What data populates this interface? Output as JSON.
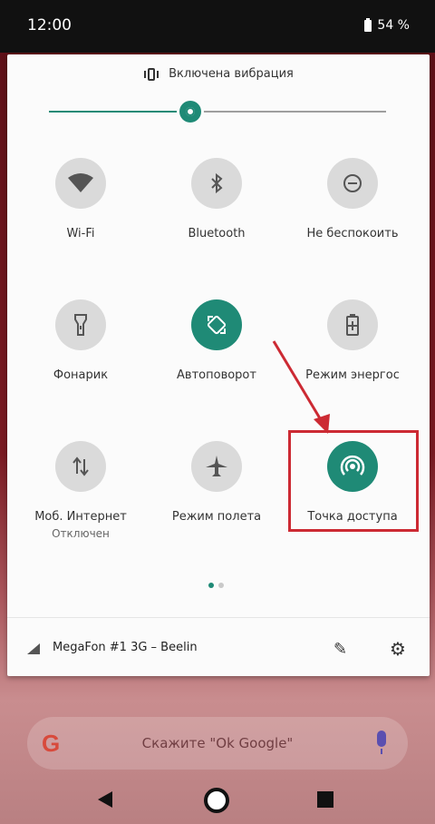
{
  "status": {
    "time": "12:00",
    "battery": "54 %"
  },
  "quick_settings": {
    "vibration_label": "Включена вибрация",
    "brightness": 0.42,
    "tiles": [
      {
        "label": "Wi-Fi",
        "sub": "",
        "icon": "wifi-icon",
        "active": false
      },
      {
        "label": "Bluetooth",
        "sub": "",
        "icon": "bluetooth-icon",
        "active": false
      },
      {
        "label": "Не беспокоить",
        "sub": "",
        "icon": "dnd-icon",
        "active": false
      },
      {
        "label": "Фонарик",
        "sub": "",
        "icon": "flashlight-icon",
        "active": false
      },
      {
        "label": "Автоповорот",
        "sub": "",
        "icon": "autorotate-icon",
        "active": true
      },
      {
        "label": "Режим энергос",
        "sub": "",
        "icon": "battery-saver-icon",
        "active": false
      },
      {
        "label": "Моб. Интернет",
        "sub": "Отключен",
        "icon": "mobile-data-icon",
        "active": false
      },
      {
        "label": "Режим полета",
        "sub": "",
        "icon": "airplane-icon",
        "active": false
      },
      {
        "label": "Точка доступа",
        "sub": "",
        "icon": "hotspot-icon",
        "active": true
      }
    ],
    "carrier": "MegaFon #1 3G – Beelin",
    "accent_color": "#1f8a76",
    "highlight_color": "#cc2a33"
  },
  "google_bar": {
    "placeholder": "Скажите \"Ok Google\"",
    "logo": "G"
  }
}
